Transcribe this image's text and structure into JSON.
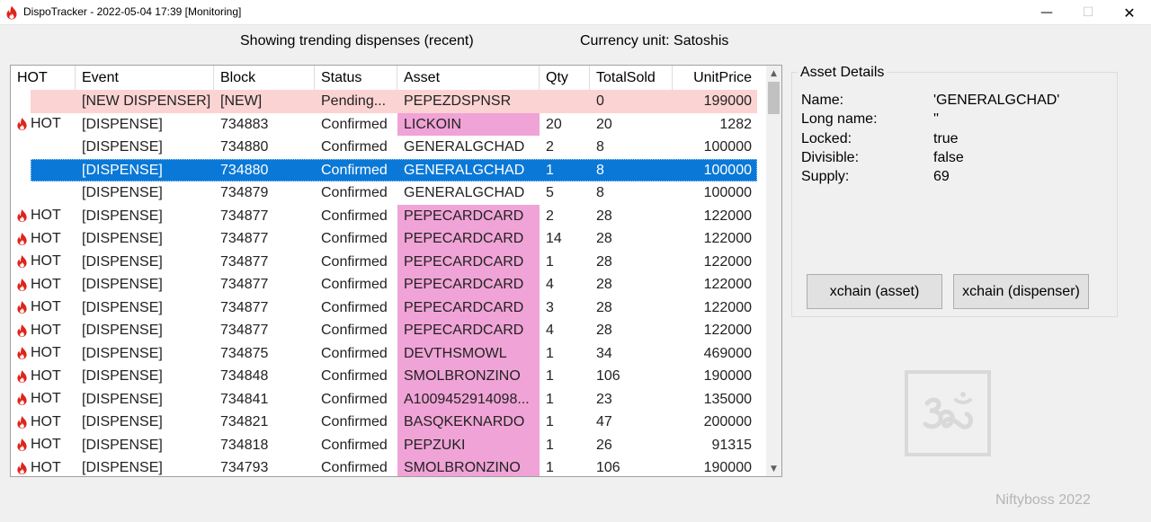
{
  "window": {
    "title": "DispoTracker - 2022-05-04 17:39 [Monitoring]"
  },
  "info": {
    "left": "Showing trending dispenses (recent)",
    "right": "Currency unit: Satoshis"
  },
  "grid": {
    "columns": [
      "HOT",
      "Event",
      "Block",
      "Status",
      "Asset",
      "Qty",
      "TotalSold",
      "UnitPrice"
    ],
    "rows": [
      {
        "hot": "",
        "event": "[NEW DISPENSER]",
        "block": "[NEW]",
        "status": "Pending...",
        "asset": "PEPEZDSPNSR",
        "qty": "",
        "total": "0",
        "price": "199000",
        "hot_asset": false,
        "state": "pending"
      },
      {
        "hot": "HOT",
        "event": "[DISPENSE]",
        "block": "734883",
        "status": "Confirmed",
        "asset": "LICKOIN",
        "qty": "20",
        "total": "20",
        "price": "1282",
        "hot_asset": true,
        "state": ""
      },
      {
        "hot": "",
        "event": "[DISPENSE]",
        "block": "734880",
        "status": "Confirmed",
        "asset": "GENERALGCHAD",
        "qty": "2",
        "total": "8",
        "price": "100000",
        "hot_asset": false,
        "state": ""
      },
      {
        "hot": "",
        "event": "[DISPENSE]",
        "block": "734880",
        "status": "Confirmed",
        "asset": "GENERALGCHAD",
        "qty": "1",
        "total": "8",
        "price": "100000",
        "hot_asset": false,
        "state": "selected"
      },
      {
        "hot": "",
        "event": "[DISPENSE]",
        "block": "734879",
        "status": "Confirmed",
        "asset": "GENERALGCHAD",
        "qty": "5",
        "total": "8",
        "price": "100000",
        "hot_asset": false,
        "state": ""
      },
      {
        "hot": "HOT",
        "event": "[DISPENSE]",
        "block": "734877",
        "status": "Confirmed",
        "asset": "PEPECARDCARD",
        "qty": "2",
        "total": "28",
        "price": "122000",
        "hot_asset": true,
        "state": ""
      },
      {
        "hot": "HOT",
        "event": "[DISPENSE]",
        "block": "734877",
        "status": "Confirmed",
        "asset": "PEPECARDCARD",
        "qty": "14",
        "total": "28",
        "price": "122000",
        "hot_asset": true,
        "state": ""
      },
      {
        "hot": "HOT",
        "event": "[DISPENSE]",
        "block": "734877",
        "status": "Confirmed",
        "asset": "PEPECARDCARD",
        "qty": "1",
        "total": "28",
        "price": "122000",
        "hot_asset": true,
        "state": ""
      },
      {
        "hot": "HOT",
        "event": "[DISPENSE]",
        "block": "734877",
        "status": "Confirmed",
        "asset": "PEPECARDCARD",
        "qty": "4",
        "total": "28",
        "price": "122000",
        "hot_asset": true,
        "state": ""
      },
      {
        "hot": "HOT",
        "event": "[DISPENSE]",
        "block": "734877",
        "status": "Confirmed",
        "asset": "PEPECARDCARD",
        "qty": "3",
        "total": "28",
        "price": "122000",
        "hot_asset": true,
        "state": ""
      },
      {
        "hot": "HOT",
        "event": "[DISPENSE]",
        "block": "734877",
        "status": "Confirmed",
        "asset": "PEPECARDCARD",
        "qty": "4",
        "total": "28",
        "price": "122000",
        "hot_asset": true,
        "state": ""
      },
      {
        "hot": "HOT",
        "event": "[DISPENSE]",
        "block": "734875",
        "status": "Confirmed",
        "asset": "DEVTHSMOWL",
        "qty": "1",
        "total": "34",
        "price": "469000",
        "hot_asset": true,
        "state": ""
      },
      {
        "hot": "HOT",
        "event": "[DISPENSE]",
        "block": "734848",
        "status": "Confirmed",
        "asset": "SMOLBRONZINO",
        "qty": "1",
        "total": "106",
        "price": "190000",
        "hot_asset": true,
        "state": ""
      },
      {
        "hot": "HOT",
        "event": "[DISPENSE]",
        "block": "734841",
        "status": "Confirmed",
        "asset": "A1009452914098...",
        "qty": "1",
        "total": "23",
        "price": "135000",
        "hot_asset": true,
        "state": ""
      },
      {
        "hot": "HOT",
        "event": "[DISPENSE]",
        "block": "734821",
        "status": "Confirmed",
        "asset": "BASQKEKNARDO",
        "qty": "1",
        "total": "47",
        "price": "200000",
        "hot_asset": true,
        "state": ""
      },
      {
        "hot": "HOT",
        "event": "[DISPENSE]",
        "block": "734818",
        "status": "Confirmed",
        "asset": "PEPZUKI",
        "qty": "1",
        "total": "26",
        "price": "91315",
        "hot_asset": true,
        "state": ""
      },
      {
        "hot": "HOT",
        "event": "[DISPENSE]",
        "block": "734793",
        "status": "Confirmed",
        "asset": "SMOLBRONZINO",
        "qty": "1",
        "total": "106",
        "price": "190000",
        "hot_asset": true,
        "state": ""
      }
    ]
  },
  "details": {
    "legend": "Asset Details",
    "fields": [
      {
        "label": "Name:",
        "value": "'GENERALGCHAD'"
      },
      {
        "label": "Long name:",
        "value": "''"
      },
      {
        "label": "Locked:",
        "value": "true"
      },
      {
        "label": "Divisible:",
        "value": "false"
      },
      {
        "label": "Supply:",
        "value": "69"
      }
    ],
    "btn_asset": "xchain (asset)",
    "btn_dispenser": "xchain (dispenser)"
  },
  "credit": "Niftyboss 2022",
  "colors": {
    "selection": "#0a78d7",
    "pending_row": "#fcd3d3",
    "hot_asset": "#f0a3d6",
    "flame": "#e0241b"
  }
}
